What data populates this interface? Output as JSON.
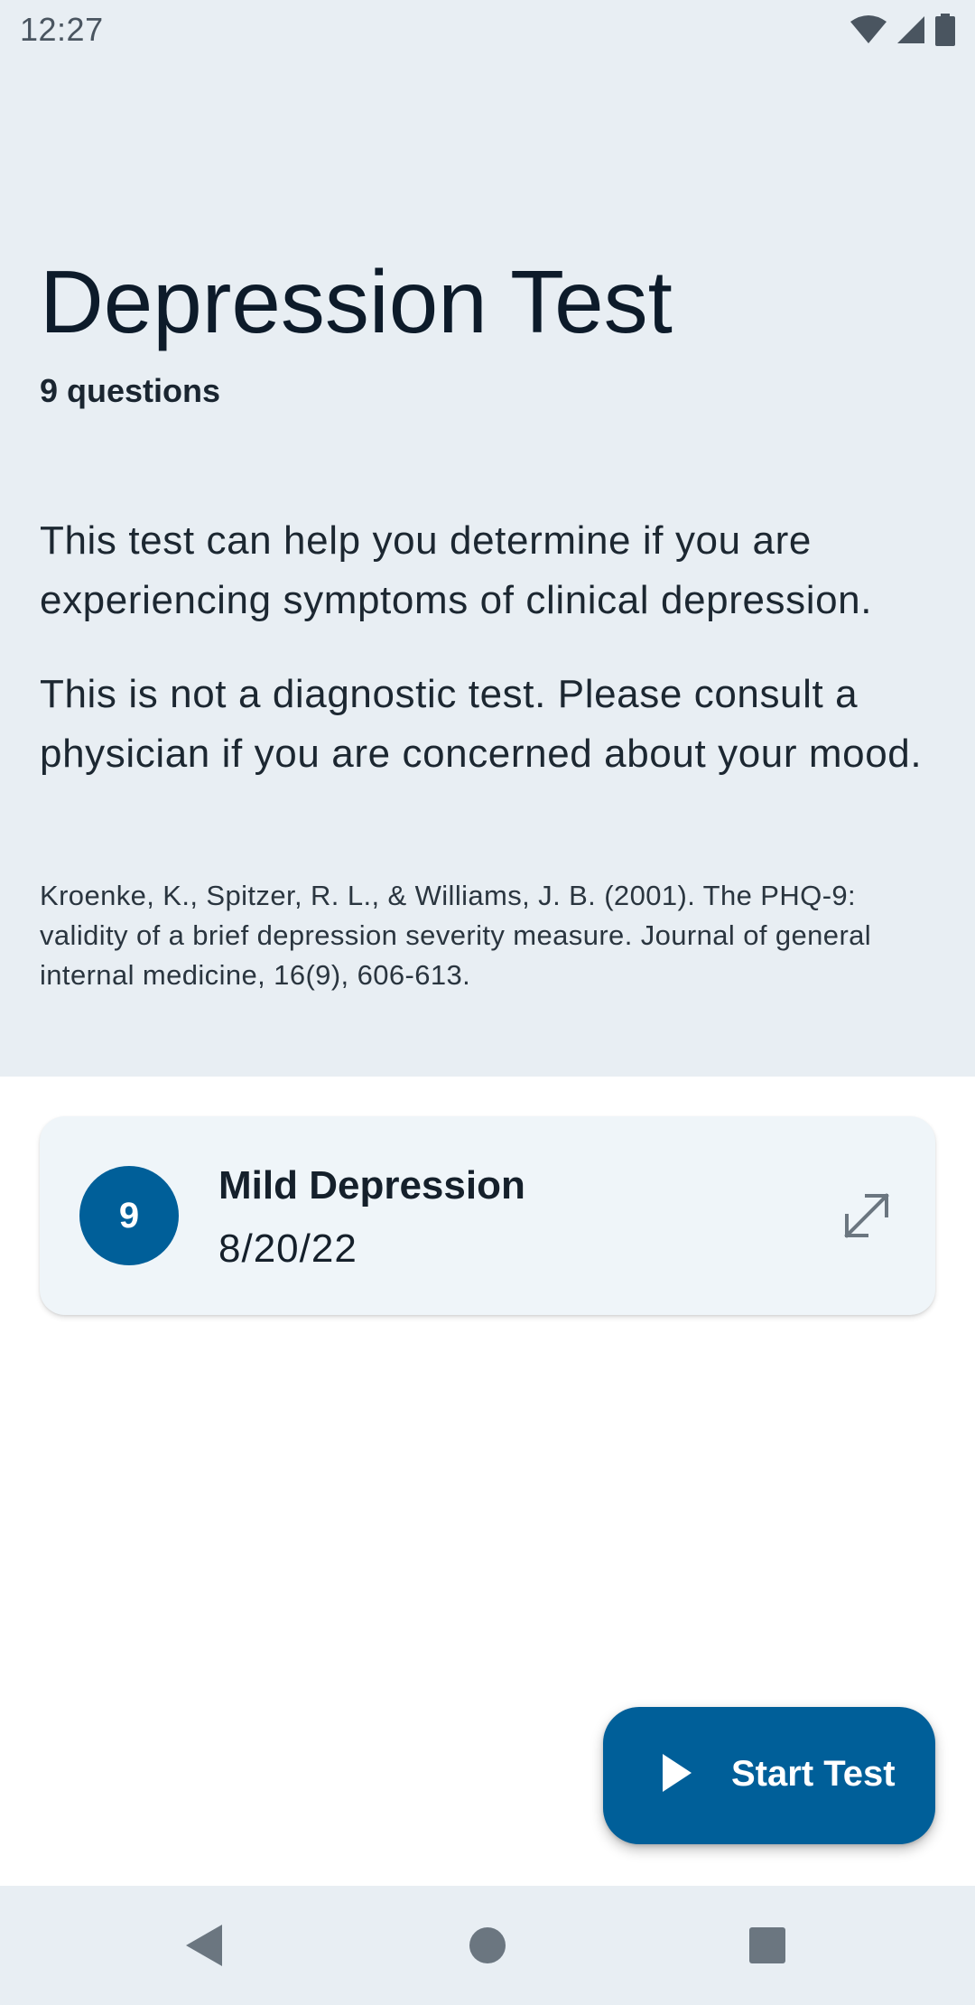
{
  "status_bar": {
    "time": "12:27",
    "icons": [
      "wifi-icon",
      "cell-signal-icon",
      "battery-icon"
    ]
  },
  "test": {
    "title": "Depression Test",
    "question_count": "9 questions",
    "description": "This test can help you determine if you are experiencing symptoms of clinical depression.",
    "disclaimer": "This is not a diagnostic test. Please consult a physician if you are concerned about your mood.",
    "citation": "Kroenke, K., Spitzer, R. L., & Williams, J. B. (2001). The PHQ-9: validity of a brief depression severity measure. Journal of general internal medicine, 16(9), 606-613."
  },
  "result_card": {
    "score": "9",
    "label": "Mild Depression",
    "date": "8/20/22",
    "action_icon": "expand-icon"
  },
  "fab": {
    "label": "Start Test",
    "icon": "play-icon"
  },
  "nav_bar": {
    "icons": [
      "back-icon",
      "home-icon",
      "recents-icon"
    ]
  },
  "colors": {
    "header_bg": "#e8eef3",
    "accent": "#005f99",
    "card_bg": "#eff5f9",
    "text": "#0d1b2a"
  }
}
